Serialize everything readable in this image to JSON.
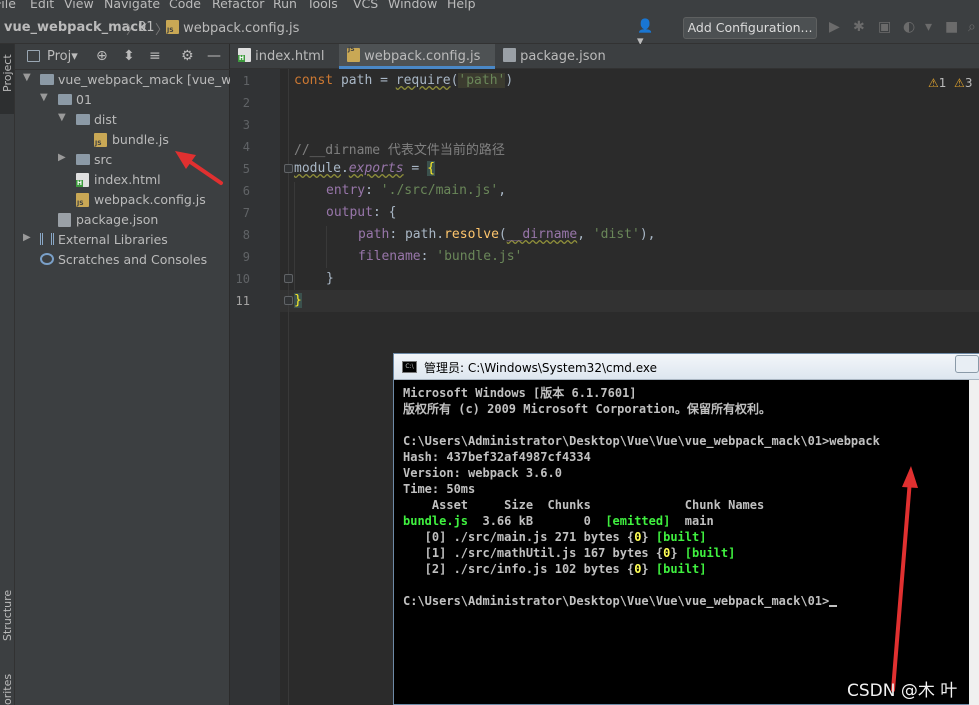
{
  "menu": [
    "File",
    "Edit",
    "View",
    "Navigate",
    "Code",
    "Refactor",
    "Run",
    "Tools",
    "VCS",
    "Window",
    "Help"
  ],
  "breadcrumb": {
    "project": "vue_webpack_mack",
    "folder": "01",
    "file": "webpack.config.js"
  },
  "toolbar": {
    "add_configuration": "Add Configuration..."
  },
  "side_tabs": {
    "project": "Project",
    "structure": "Structure",
    "favorites": "orites"
  },
  "project_panel": {
    "title": "Proj▾",
    "tree": [
      {
        "label": "vue_webpack_mack [vue_web",
        "type": "folder",
        "expanded": true
      },
      {
        "label": "01",
        "type": "folder",
        "expanded": true
      },
      {
        "label": "dist",
        "type": "folder",
        "expanded": true
      },
      {
        "label": "bundle.js",
        "type": "js"
      },
      {
        "label": "src",
        "type": "folder",
        "expanded": false
      },
      {
        "label": "index.html",
        "type": "html"
      },
      {
        "label": "webpack.config.js",
        "type": "js"
      },
      {
        "label": "package.json",
        "type": "json"
      },
      {
        "label": "External Libraries",
        "type": "libs",
        "expanded": false
      },
      {
        "label": "Scratches and Consoles",
        "type": "scratch"
      }
    ]
  },
  "tabs": [
    {
      "label": "index.html",
      "icon": "html-icon",
      "active": false
    },
    {
      "label": "webpack.config.js",
      "icon": "js-icon",
      "active": true
    },
    {
      "label": "package.json",
      "icon": "json-icon",
      "active": false
    }
  ],
  "editor": {
    "line_numbers": [
      "1",
      "2",
      "3",
      "4",
      "5",
      "6",
      "7",
      "8",
      "9",
      "10",
      "11"
    ],
    "current_line": 11,
    "warnings": {
      "warn_count": "1",
      "weak_count": "3"
    },
    "code": {
      "l1_kw": "const",
      "l1_a": " path = ",
      "l1_fn": "require",
      "l1_b": "(",
      "l1_str": "'path'",
      "l1_c": ")",
      "l4_cmt": "//__dirname 代表文件当前的路径",
      "l5_a": "module",
      "l5_b": ".",
      "l5_prop": "exports",
      "l5_c": " = ",
      "l5_brace": "{",
      "l6_prop": "entry",
      "l6_a": ": ",
      "l6_str": "'./src/main.js'",
      "l6_b": ",",
      "l7_prop": "output",
      "l7_a": ": {",
      "l8_prop": "path",
      "l8_a": ": path.",
      "l8_fn": "resolve",
      "l8_b": "(",
      "l8_prm": "__dirname",
      "l8_c": ", ",
      "l8_str": "'dist'",
      "l8_d": "),",
      "l9_prop": "filename",
      "l9_a": ": ",
      "l9_str": "'bundle.js'",
      "l10": "}",
      "l11_brace": "}"
    }
  },
  "cmd": {
    "title": "管理员: C:\\Windows\\System32\\cmd.exe",
    "lines": {
      "l1": "Microsoft Windows [版本 6.1.7601]",
      "l2": "版权所有 (c) 2009 Microsoft Corporation。保留所有权利。",
      "l4": "C:\\Users\\Administrator\\Desktop\\Vue\\Vue\\vue_webpack_mack\\01>webpack",
      "l5": "Hash: 437bef32af4987cf4334",
      "l6": "Version: webpack 3.6.0",
      "l7": "Time: 50ms",
      "l8": "    Asset     Size  Chunks             Chunk Names",
      "l9_asset": "bundle.js",
      "l9_a": "  3.66 kB       0  ",
      "l9_emitted": "[emitted]",
      "l9_b": "  main",
      "l10_a": "   [0] ./src/main.js 271 bytes {",
      "l10_n": "0",
      "l10_b": "} ",
      "l10_built": "[built]",
      "l11_a": "   [1] ./src/mathUtil.js 167 bytes {",
      "l11_n": "0",
      "l11_b": "} ",
      "l11_built": "[built]",
      "l12_a": "   [2] ./src/info.js 102 bytes {",
      "l12_n": "0",
      "l12_b": "} ",
      "l12_built": "[built]",
      "l14": "C:\\Users\\Administrator\\Desktop\\Vue\\Vue\\vue_webpack_mack\\01>"
    }
  },
  "watermark": "CSDN @木 叶",
  "colors": {
    "annotation_arrow": "#e03030",
    "accent_tab": "#4a88c7"
  }
}
